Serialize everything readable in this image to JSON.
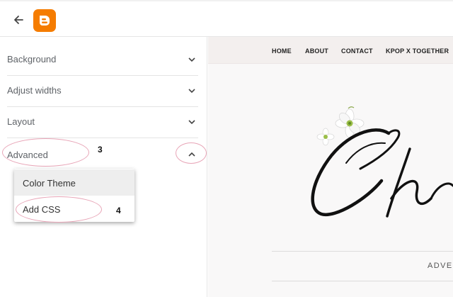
{
  "sidebar": {
    "sections": [
      {
        "label": "Background"
      },
      {
        "label": "Adjust widths"
      },
      {
        "label": "Layout"
      },
      {
        "label": "Advanced"
      }
    ]
  },
  "advanced_menu": {
    "items": [
      {
        "label": "Color Theme"
      },
      {
        "label": "Add CSS"
      }
    ]
  },
  "annotations": {
    "step_advanced": "3",
    "step_add_css": "4",
    "highlight_color": "#e8a5b7"
  },
  "preview": {
    "nav": [
      "HOME",
      "ABOUT",
      "CONTACT",
      "KPOP X TOGETHER"
    ],
    "banner_text": "ADVER"
  },
  "icons": {
    "back": "arrow-left-icon",
    "logo": "blogger-logo",
    "collapsed": "chevron-down-icon",
    "expanded": "chevron-up-icon"
  },
  "colors": {
    "blogger_orange": "#f57c00",
    "nav_background": "#f3efee"
  }
}
